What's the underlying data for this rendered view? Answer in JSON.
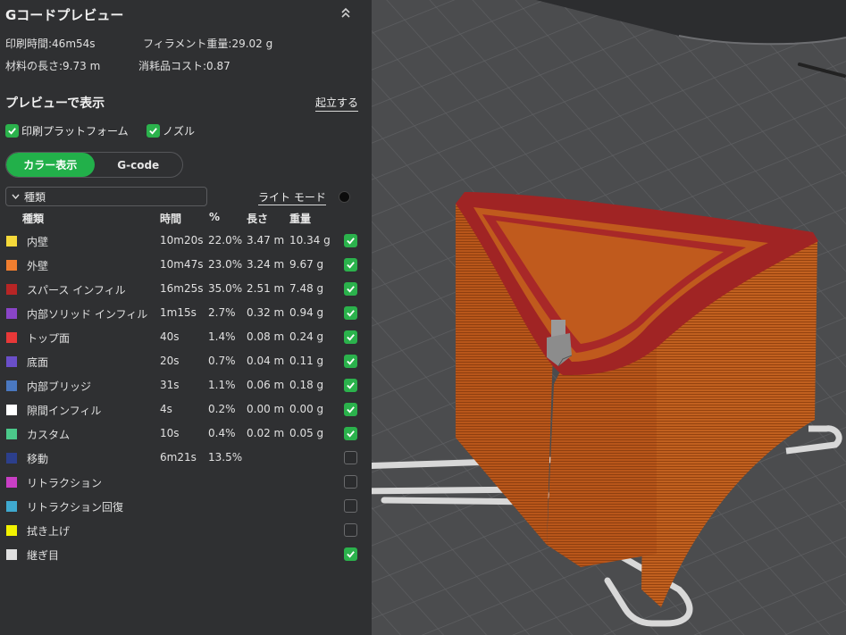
{
  "panel": {
    "title": "Gコードプレビュー",
    "collapse_icon": "double-chevron-up-icon",
    "print_time": "印刷時間:46m54s",
    "filament_weight": "フィラメント重量:29.02 g",
    "material_length": "材料の長さ:9.73 m",
    "consumable_cost": "消耗品コスト:0.87",
    "preview_title": "プレビューで表示",
    "stand_link": "起立する",
    "show_plate_label": "印刷プラットフォーム",
    "show_plate_checked": true,
    "show_nozzle_label": "ノズル",
    "show_nozzle_checked": true,
    "tabs": [
      {
        "label": "カラー表示",
        "active": true
      },
      {
        "label": "G-code",
        "active": false
      }
    ],
    "type_dropdown": "種類",
    "light_mode_label": "ライト モード",
    "columns": {
      "type": "種類",
      "time": "時間",
      "percent": "%",
      "length": "長さ",
      "weight": "重量"
    }
  },
  "rows": [
    {
      "color": "#f5d93a",
      "name": "内壁",
      "time": "10m20s",
      "percent": "22.0%",
      "length": "3.47 m",
      "weight": "10.34 g",
      "checked": true
    },
    {
      "color": "#f07e2f",
      "name": "外壁",
      "time": "10m47s",
      "percent": "23.0%",
      "length": "3.24 m",
      "weight": "9.67 g",
      "checked": true
    },
    {
      "color": "#b72525",
      "name": "スパース インフィル",
      "time": "16m25s",
      "percent": "35.0%",
      "length": "2.51 m",
      "weight": "7.48 g",
      "checked": true
    },
    {
      "color": "#8a45c8",
      "name": "内部ソリッド インフィル",
      "time": "1m15s",
      "percent": "2.7%",
      "length": "0.32 m",
      "weight": "0.94 g",
      "checked": true
    },
    {
      "color": "#e83838",
      "name": "トップ面",
      "time": "40s",
      "percent": "1.4%",
      "length": "0.08 m",
      "weight": "0.24 g",
      "checked": true
    },
    {
      "color": "#6a4fc9",
      "name": "底面",
      "time": "20s",
      "percent": "0.7%",
      "length": "0.04 m",
      "weight": "0.11 g",
      "checked": true
    },
    {
      "color": "#4a78c0",
      "name": "内部ブリッジ",
      "time": "31s",
      "percent": "1.1%",
      "length": "0.06 m",
      "weight": "0.18 g",
      "checked": true
    },
    {
      "color": "#ffffff",
      "name": "隙間インフィル",
      "time": "4s",
      "percent": "0.2%",
      "length": "0.00 m",
      "weight": "0.00 g",
      "checked": true
    },
    {
      "color": "#4bc98a",
      "name": "カスタム",
      "time": "10s",
      "percent": "0.4%",
      "length": "0.02 m",
      "weight": "0.05 g",
      "checked": true
    },
    {
      "color": "#2c3f8c",
      "name": "移動",
      "time": "6m21s",
      "percent": "13.5%",
      "length": "",
      "weight": "",
      "checked": false
    },
    {
      "color": "#c93fc5",
      "name": "リトラクション",
      "time": "",
      "percent": "",
      "length": "",
      "weight": "",
      "checked": false
    },
    {
      "color": "#3fa9cf",
      "name": "リトラクション回復",
      "time": "",
      "percent": "",
      "length": "",
      "weight": "",
      "checked": false
    },
    {
      "color": "#f2f200",
      "name": "拭き上げ",
      "time": "",
      "percent": "",
      "length": "",
      "weight": "",
      "checked": false
    },
    {
      "color": "#e0e0e0",
      "name": "継ぎ目",
      "time": "",
      "percent": "",
      "length": "",
      "weight": "",
      "checked": true
    }
  ]
}
